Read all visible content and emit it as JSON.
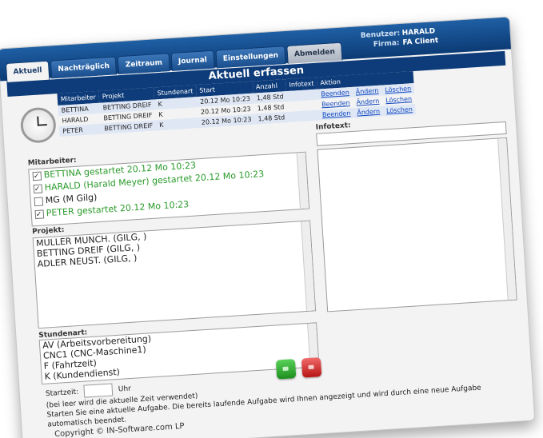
{
  "header": {
    "user_label": "Benutzer:",
    "user_value": "HARALD",
    "company_label": "Firma:",
    "company_value": "FA Client"
  },
  "tabs": [
    {
      "label": "Aktuell"
    },
    {
      "label": "Nachträglich"
    },
    {
      "label": "Zeitraum"
    },
    {
      "label": "Journal"
    },
    {
      "label": "Einstellungen"
    },
    {
      "label": "Abmelden"
    }
  ],
  "page_title": "Aktuell erfassen",
  "running_table": {
    "headers": [
      "Mitarbeiter",
      "Projekt",
      "Stundenart",
      "Start",
      "Anzahl",
      "Infotext",
      "Aktion"
    ],
    "rows": [
      {
        "mitarbeiter": "BETTINA",
        "projekt": "BETTING DREIF",
        "stundenart": "K",
        "start": "20.12 Mo 10:23",
        "anzahl": "1,48 Std",
        "infotext": "",
        "a1": "Beenden",
        "a2": "Ändern",
        "a3": "Löschen"
      },
      {
        "mitarbeiter": "HARALD",
        "projekt": "BETTING DREIF",
        "stundenart": "K",
        "start": "20.12 Mo 10:23",
        "anzahl": "1,48 Std",
        "infotext": "",
        "a1": "Beenden",
        "a2": "Ändern",
        "a3": "Löschen"
      },
      {
        "mitarbeiter": "PETER",
        "projekt": "BETTING DREIF",
        "stundenart": "K",
        "start": "20.12 Mo 10:23",
        "anzahl": "1,48 Std",
        "infotext": "",
        "a1": "Beenden",
        "a2": "Ändern",
        "a3": "Löschen"
      }
    ]
  },
  "mitarbeiter": {
    "label": "Mitarbeiter:",
    "items": [
      {
        "text": "BETTINA gestartet 20.12 Mo 10:23",
        "checked": true
      },
      {
        "text": "HARALD (Harald Meyer) gestartet 20.12 Mo 10:23",
        "checked": true
      },
      {
        "text": "MG (M Gilg)",
        "checked": false
      },
      {
        "text": "PETER gestartet 20.12 Mo 10:23",
        "checked": true
      }
    ]
  },
  "projekt": {
    "label": "Projekt:",
    "items": [
      "MULLER MUNCH. (GILG, )",
      "BETTING DREIF (GILG, )",
      "ADLER NEUST. (GILG, )"
    ]
  },
  "stundenart": {
    "label": "Stundenart:",
    "items": [
      "AV (Arbeitsvorbereitung)",
      "CNC1 (CNC-Maschine1)",
      "F (Fahrtzeit)",
      "K (Kundendienst)"
    ]
  },
  "infotext": {
    "label": "Infotext:",
    "value": ""
  },
  "startzeit": {
    "label": "Startzeit:",
    "unit": "Uhr",
    "value": ""
  },
  "notes": [
    "(bei leer wird die aktuelle Zeit verwendet)",
    "Starten Sie eine aktuelle Aufgabe. Die bereits laufende Aufgabe wird Ihnen angezeigt und wird durch eine neue Aufgabe",
    "automatisch beendet."
  ],
  "buttons": {
    "start_color": "#2aa52a",
    "stop_color": "#cc2222"
  },
  "footer": "Copyright © IN-Software.com LP"
}
